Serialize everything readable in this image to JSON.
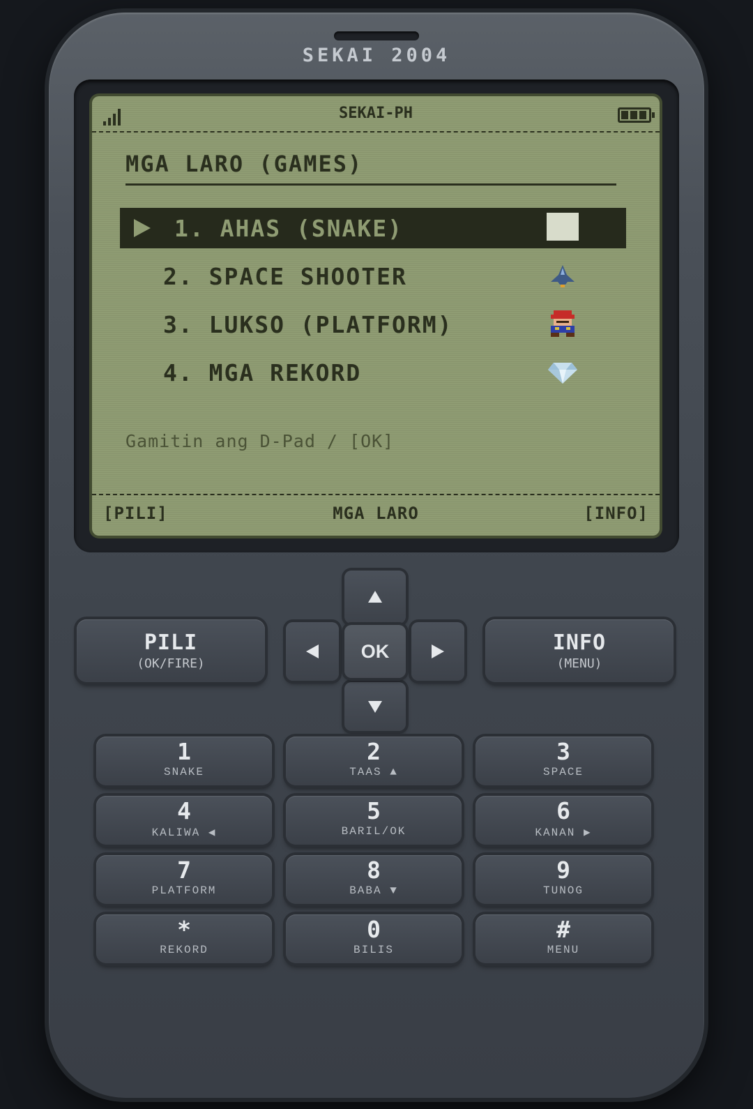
{
  "device": {
    "brand": "SEKAI 2004"
  },
  "screen": {
    "carrier": "SEKAI-PH",
    "title": "MGA LARO (GAMES)",
    "menu": [
      {
        "label": "1. AHAS (SNAKE)",
        "icon": "white-square-icon",
        "selected": true
      },
      {
        "label": "2. SPACE SHOOTER",
        "icon": "spaceship-icon",
        "selected": false
      },
      {
        "label": "3. LUKSO (PLATFORM)",
        "icon": "plumber-sprite-icon",
        "selected": false
      },
      {
        "label": "4. MGA REKORD",
        "icon": "diamond-icon",
        "selected": false
      }
    ],
    "hint": "Gamitin ang D-Pad / [OK]",
    "softkeys": {
      "left": "[PILI]",
      "center": "MGA LARO",
      "right": "[INFO]"
    }
  },
  "controls": {
    "left_soft": {
      "label": "PILI",
      "sub": "(OK/FIRE)"
    },
    "right_soft": {
      "label": "INFO",
      "sub": "(MENU)"
    },
    "ok": "OK"
  },
  "keypad": [
    {
      "num": "1",
      "sub": "SNAKE"
    },
    {
      "num": "2",
      "sub": "TAAS ▲"
    },
    {
      "num": "3",
      "sub": "SPACE"
    },
    {
      "num": "4",
      "sub": "KALIWA ◀"
    },
    {
      "num": "5",
      "sub": "BARIL/OK"
    },
    {
      "num": "6",
      "sub": "KANAN ▶"
    },
    {
      "num": "7",
      "sub": "PLATFORM"
    },
    {
      "num": "8",
      "sub": "BABA ▼"
    },
    {
      "num": "9",
      "sub": "TUNOG"
    },
    {
      "num": "*",
      "sub": "REKORD"
    },
    {
      "num": "0",
      "sub": "BILIS"
    },
    {
      "num": "#",
      "sub": "MENU"
    }
  ]
}
